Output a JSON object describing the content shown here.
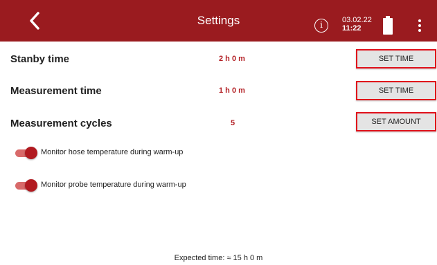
{
  "header": {
    "title": "Settings",
    "date": "03.02.22",
    "time": "11:22",
    "back_icon": "chevron-left-icon",
    "info_icon": "info-icon",
    "info_glyph": "i",
    "menu_icon": "kebab-menu-icon",
    "battery_icon": "battery-full-icon",
    "bar_color": "#9a1b1f"
  },
  "settings": {
    "standby": {
      "label": "Stanby time",
      "value": "2 h 0 m",
      "button": "SET TIME"
    },
    "measurement": {
      "label": "Measurement time",
      "value": "1 h 0 m",
      "button": "SET TIME"
    },
    "cycles": {
      "label": "Measurement cycles",
      "value": "5",
      "button": "SET AMOUNT"
    }
  },
  "toggles": {
    "hose": {
      "label": "Monitor hose temperature during warm-up",
      "checked": true
    },
    "probe": {
      "label": "Monitor probe temperature during warm-up",
      "checked": true
    }
  },
  "footer": {
    "expected_time": "Expected time: ≈ 15 h 0 m"
  },
  "colors": {
    "accent": "#9a1b1f",
    "value_text": "#b31f24",
    "button_border": "#e0101a",
    "toggle_knob": "#b11a20",
    "toggle_track": "#d86a6a"
  }
}
